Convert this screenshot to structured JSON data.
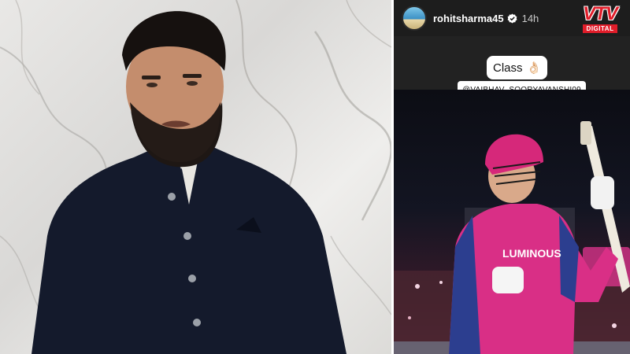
{
  "story": {
    "username": "rohitsharma45",
    "timestamp": "14h",
    "sticker_text": "Class",
    "sticker_emoji": "👌🏻",
    "mention": "@VAIBHAV_SOORYAVANSHI09",
    "jersey_text": "LUMINOUS",
    "verified_color": "#ffffff"
  },
  "logo": {
    "main": "VTV",
    "sub": "DIGITAL",
    "color": "#e11d2a"
  },
  "icons": {
    "verified": "verified-badge-icon",
    "emoji": "ok-hand-emoji"
  }
}
